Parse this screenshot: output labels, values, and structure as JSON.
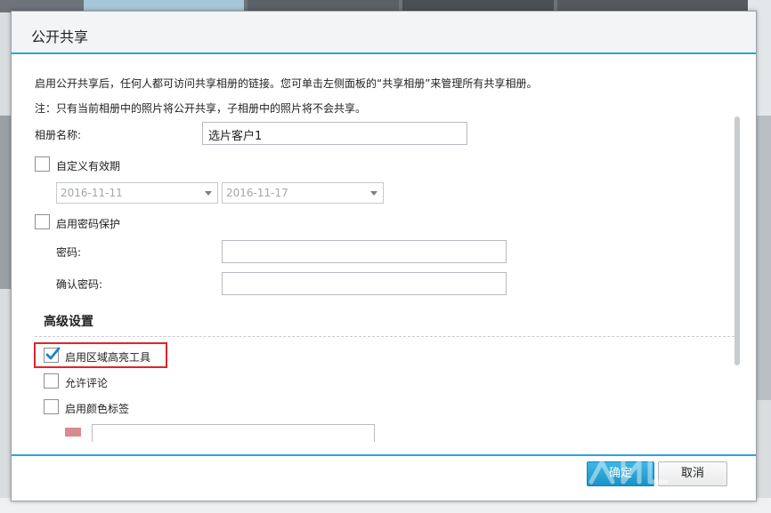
{
  "dialog": {
    "title": "公开共享",
    "intro": "启用公开共享后，任何人都可访问共享相册的链接。您可单击左侧面板的“共享相册”来管理所有共享相册。",
    "note": "注：只有当前相册中的照片将公开共享，子相册中的照片将不会共享。",
    "album_name_label": "相册名称:",
    "album_name_value": "选片客户1",
    "custom_validity_label": "自定义有效期",
    "date_start": "2016-11-11",
    "date_end": "2016-11-17",
    "password_protection_label": "启用密码保护",
    "password_label": "密码:",
    "confirm_password_label": "确认密码:",
    "advanced_title": "高级设置",
    "area_highlight_label": "启用区域高亮工具",
    "allow_comments_label": "允许评论",
    "color_label_label": "启用颜色标签",
    "ok_label": "确定",
    "cancel_label": "取消"
  },
  "colors": {
    "accent": "#2ea3d7",
    "highlight_border": "#e3232b",
    "swatch": "#d98a8f"
  }
}
